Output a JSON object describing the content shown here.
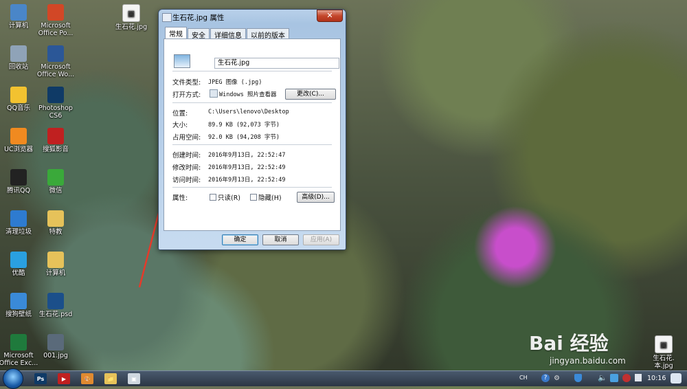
{
  "desktop": {
    "icons_left": [
      {
        "label": "计算机",
        "icon": "computer-icon",
        "color": "#4a86c8"
      },
      {
        "label": "回收站",
        "icon": "recycle-bin-icon",
        "color": "#8fa3b8"
      },
      {
        "label": "QQ音乐",
        "icon": "qq-music-icon",
        "color": "#f2c230"
      },
      {
        "label": "UC浏览器",
        "icon": "uc-browser-icon",
        "color": "#f08a20"
      },
      {
        "label": "腾讯QQ",
        "icon": "qq-icon",
        "color": "#222222"
      },
      {
        "label": "清理垃圾",
        "icon": "cleanup-icon",
        "color": "#2e7bd0"
      },
      {
        "label": "优酷",
        "icon": "youku-icon",
        "color": "#2aa0e0"
      },
      {
        "label": "搜狗壁纸",
        "icon": "sogou-wallpaper-icon",
        "color": "#3a8ad8"
      },
      {
        "label": "Microsoft\nOffice Exc...",
        "icon": "excel-icon",
        "color": "#1f7a3c"
      }
    ],
    "icons_right": [
      {
        "label": "Microsoft\nOffice Po...",
        "icon": "powerpoint-icon",
        "color": "#d24726"
      },
      {
        "label": "Microsoft\nOffice Wo...",
        "icon": "word-icon",
        "color": "#2b5797"
      },
      {
        "label": "Photoshop\nCS6",
        "icon": "photoshop-icon",
        "color": "#0f3a66"
      },
      {
        "label": "搜狐影音",
        "icon": "sohu-video-icon",
        "color": "#c02020"
      },
      {
        "label": "微信",
        "icon": "wechat-icon",
        "color": "#3aa93a"
      },
      {
        "label": "特教",
        "icon": "folder-icon",
        "color": "#e6c25a"
      },
      {
        "label": "计算机",
        "icon": "folder-icon",
        "color": "#e6c25a"
      },
      {
        "label": "生石花.psd",
        "icon": "psd-file-icon",
        "color": "#1b4f8a"
      },
      {
        "label": "001.jpg",
        "icon": "image-file-icon",
        "color": "#5a6a7a"
      }
    ],
    "file_top": {
      "label": "生石花.jpg",
      "icon": "image-file-icon"
    },
    "file_bottom_right": {
      "label": "生石花.\n本.jpg"
    }
  },
  "dialog": {
    "title": "生石花.jpg 属性",
    "close": "✕",
    "tabs": [
      "常规",
      "安全",
      "详细信息",
      "以前的版本"
    ],
    "filename": "生石花.jpg",
    "file_type_label": "文件类型:",
    "file_type_value": "JPEG 图像 (.jpg)",
    "open_with_label": "打开方式:",
    "open_with_value": "Windows 照片查看器",
    "change_button": "更改(C)...",
    "location_label": "位置:",
    "location_value": "C:\\Users\\lenovo\\Desktop",
    "size_label": "大小:",
    "size_value": "89.9 KB (92,073 字节)",
    "disk_size_label": "占用空间:",
    "disk_size_value": "92.0 KB (94,208 字节)",
    "created_label": "创建时间:",
    "created_value": "2016年9月13日, 22:52:47",
    "modified_label": "修改时间:",
    "modified_value": "2016年9月13日, 22:52:49",
    "accessed_label": "访问时间:",
    "accessed_value": "2016年9月13日, 22:52:49",
    "attributes_label": "属性:",
    "readonly_label": "只读(R)",
    "hidden_label": "隐藏(H)",
    "advanced_button": "高级(D)...",
    "ok_button": "确定",
    "cancel_button": "取消",
    "apply_button": "应用(A)"
  },
  "taskbar": {
    "lang": "CH",
    "clock": "10:16",
    "items": [
      {
        "icon": "photoshop-icon",
        "color": "#0f3a66",
        "text": "Ps"
      },
      {
        "icon": "sohu-video-icon",
        "color": "#c02020",
        "text": "▶"
      },
      {
        "icon": "paint-icon",
        "color": "#e08a30",
        "text": "🎨"
      },
      {
        "icon": "explorer-icon",
        "color": "#e6c25a",
        "text": "📁"
      },
      {
        "icon": "photo-viewer-icon",
        "color": "#d0d8e0",
        "text": "▣"
      }
    ]
  },
  "watermark": {
    "brand": "Bai 经验",
    "url": "jingyan.baidu.com"
  }
}
